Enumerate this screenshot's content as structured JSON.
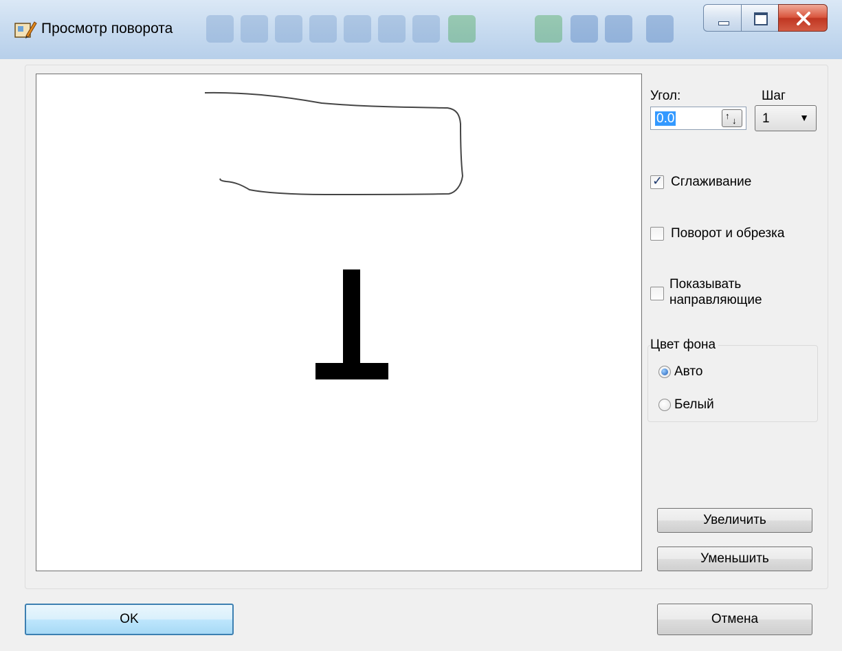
{
  "window": {
    "title": "Просмотр поворота",
    "icons": {
      "app": "rotate-edit-icon",
      "minimize": "minimize-icon",
      "maximize": "maximize-icon",
      "close": "close-icon"
    }
  },
  "preview": {
    "background": "#ffffff"
  },
  "controls": {
    "angle_label": "Угол:",
    "angle_value": "0.0",
    "step_label": "Шаг",
    "step_value": "1",
    "smoothing_label": "Сглаживание",
    "smoothing_checked": true,
    "rotate_crop_label": "Поворот и обрезка",
    "rotate_crop_checked": false,
    "show_guides_label_line1": "Показывать",
    "show_guides_label_line2": "направляющие",
    "show_guides_checked": false,
    "bg_color_group_label": "Цвет фона",
    "bg_auto_label": "Авто",
    "bg_white_label": "Белый",
    "bg_selected": "Авто",
    "zoom_in_label": "Увеличить",
    "zoom_out_label": "Уменьшить"
  },
  "footer": {
    "ok_label": "OK",
    "cancel_label": "Отмена"
  },
  "colors": {
    "accent": "#3399ff",
    "close_button": "#c94a35",
    "titlebar": "#c9dcf0"
  }
}
